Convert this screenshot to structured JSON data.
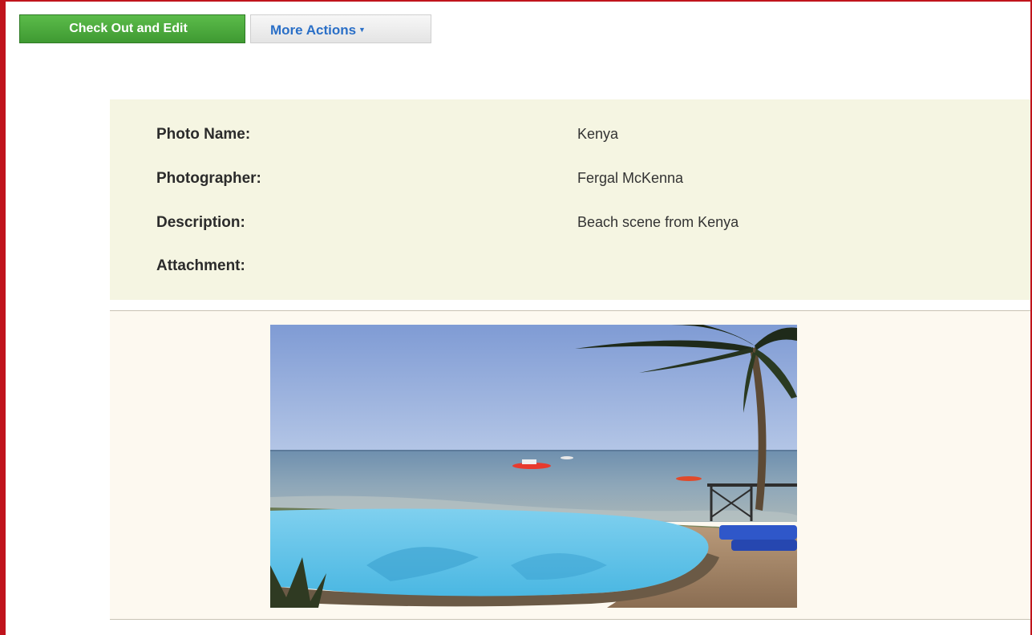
{
  "toolbar": {
    "checkout_label": "Check Out and Edit",
    "more_actions_label": "More Actions",
    "more_actions_caret": "▼"
  },
  "record": {
    "fields": [
      {
        "label": "Photo Name:",
        "value": "Kenya"
      },
      {
        "label": "Photographer:",
        "value": "Fergal McKenna"
      },
      {
        "label": "Description:",
        "value": "Beach scene from Kenya"
      },
      {
        "label": "Attachment:",
        "value": ""
      }
    ]
  },
  "colors": {
    "frame_border": "#c0141c",
    "primary_button": "#4aa83c",
    "link_blue": "#2a6fc7",
    "meta_background": "#f5f5e2"
  }
}
